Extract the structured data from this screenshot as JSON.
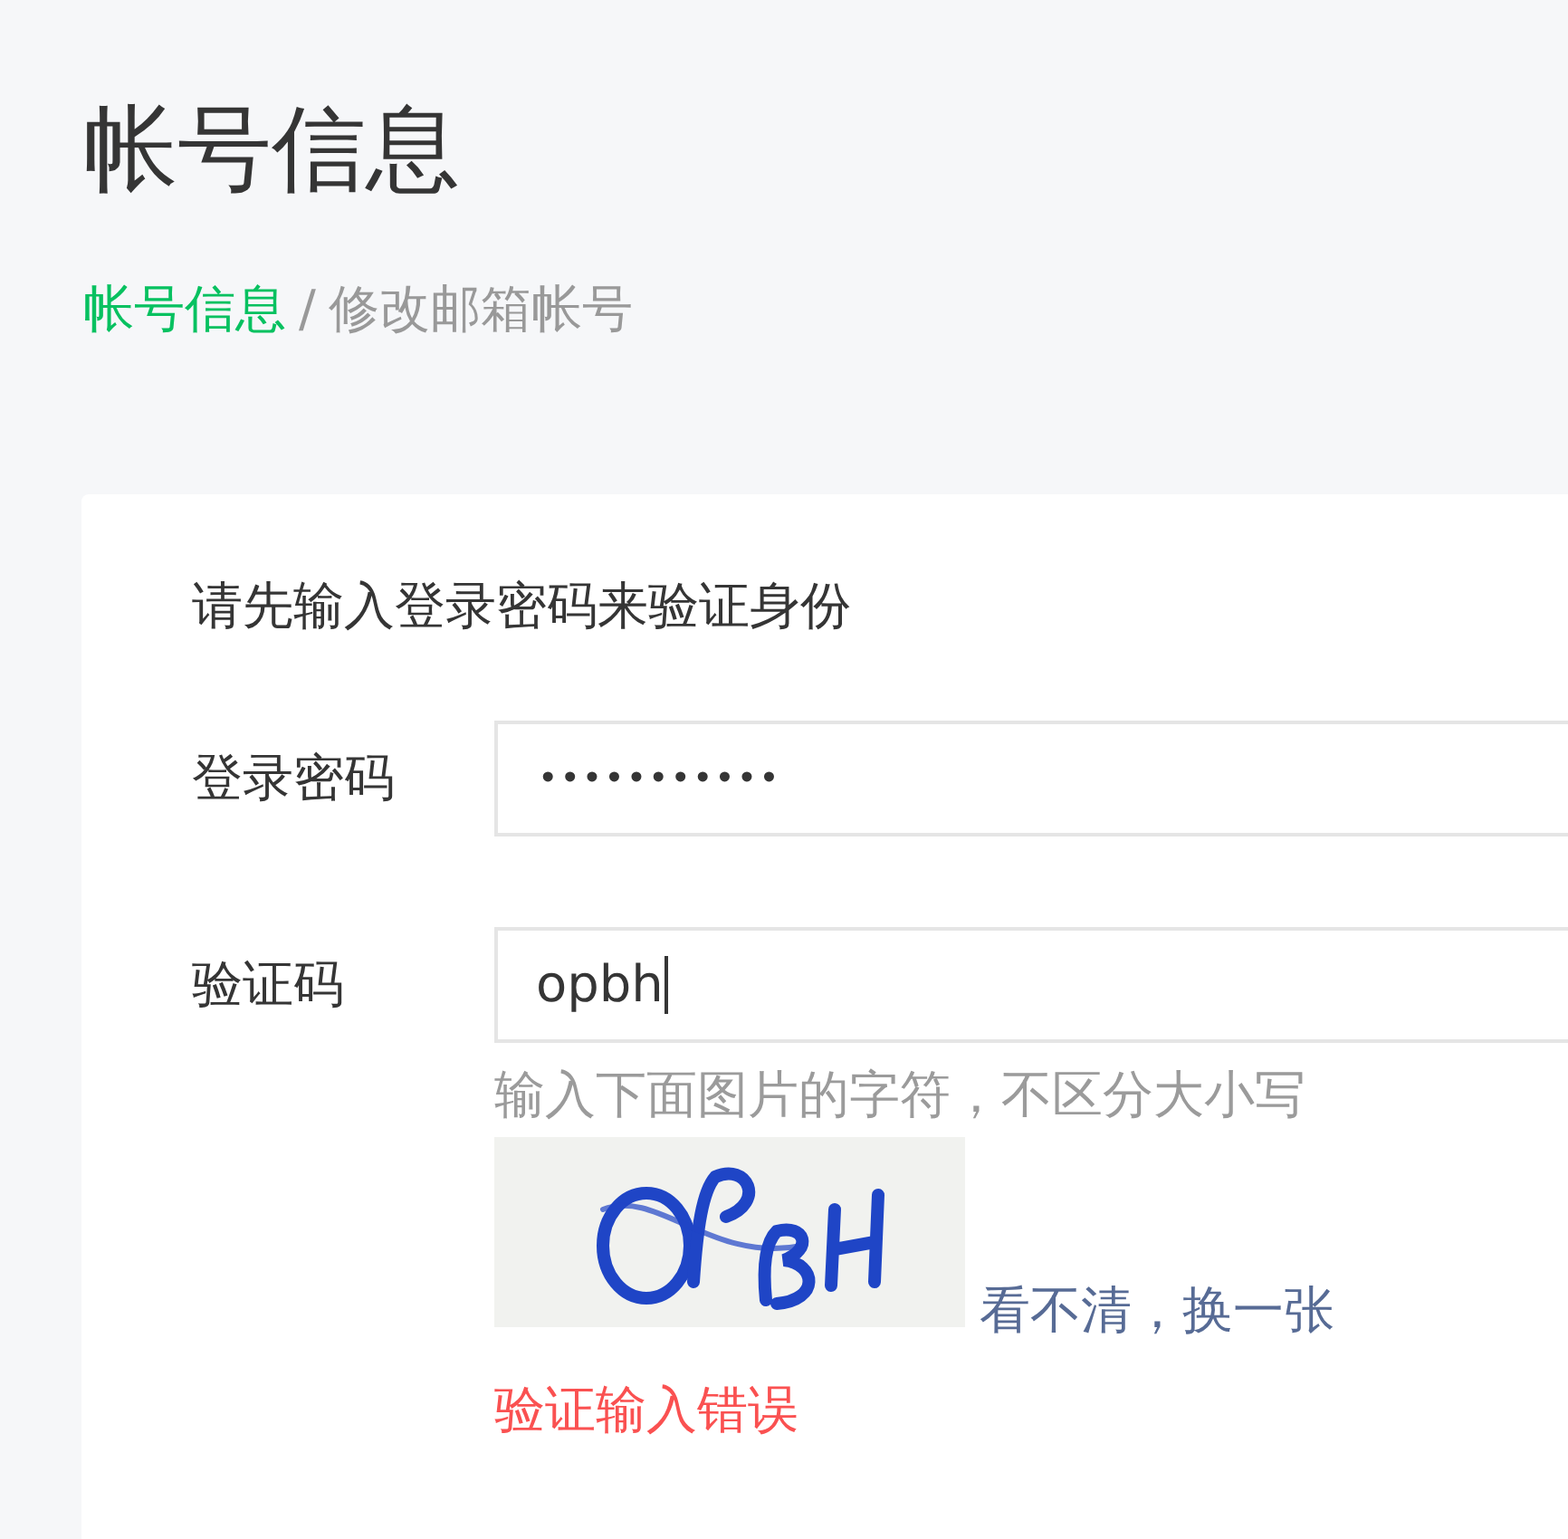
{
  "page": {
    "title": "帐号信息"
  },
  "breadcrumb": {
    "items": [
      {
        "label": "帐号信息",
        "kind": "link"
      },
      {
        "label": "修改邮箱帐号",
        "kind": "current"
      }
    ],
    "separator": "/"
  },
  "form": {
    "intro": "请先输入登录密码来验证身份",
    "fields": [
      {
        "kind": "password",
        "label": "登录密码",
        "value": "•••••••••••",
        "focused": false
      },
      {
        "kind": "captcha",
        "label": "验证码",
        "value": "opbh",
        "focused": true,
        "hint": "输入下面图片的字符，不区分大小写",
        "refresh_link": "看不清，换一张",
        "error": "验证输入错误"
      }
    ]
  }
}
